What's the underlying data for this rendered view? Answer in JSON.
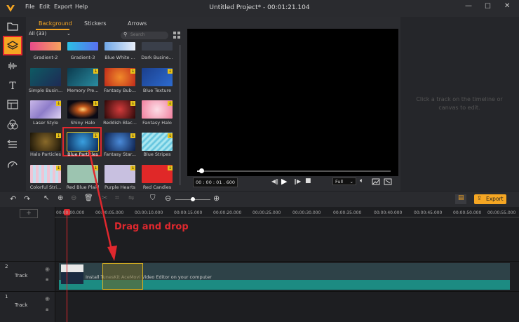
{
  "titlebar": {
    "menu": [
      "File",
      "Edit",
      "Export",
      "Help"
    ],
    "title": "Untitled Project* - 00:01:21.104"
  },
  "media": {
    "tabs": [
      "Background",
      "Stickers",
      "Arrows"
    ],
    "filter": "All (33)",
    "search_placeholder": "Search",
    "items": [
      {
        "label": "Gradient-2"
      },
      {
        "label": "Gradient-3"
      },
      {
        "label": "Blue White ..."
      },
      {
        "label": "Dark Busine..."
      },
      {
        "label": "Simple Busin..."
      },
      {
        "label": "Memory Pre..."
      },
      {
        "label": "Fantasy Bub..."
      },
      {
        "label": "Blue Texture"
      },
      {
        "label": "Laser Style"
      },
      {
        "label": "Shiny Halo"
      },
      {
        "label": "Reddish Blac..."
      },
      {
        "label": "Fantasy Halo"
      },
      {
        "label": "Halo Particles"
      },
      {
        "label": "Blue Particles"
      },
      {
        "label": "Fantasy Star..."
      },
      {
        "label": "Blue Stripes"
      },
      {
        "label": "Colorful Stri..."
      },
      {
        "label": "Red Blue Plaid"
      },
      {
        "label": "Purple Hearts"
      },
      {
        "label": "Red Candies"
      }
    ]
  },
  "preview": {
    "timecode": "00 : 00 : 01 . 600",
    "quality": "Full",
    "progress": 0.02
  },
  "properties": {
    "hint": "Click a track on the timeline or canvas to edit."
  },
  "timeline": {
    "export_label": "Export",
    "ticks": [
      "00:00:00.000",
      "00:00:05.000",
      "00:00:10.000",
      "00:00:15.000",
      "00:00:20.000",
      "00:00:25.000",
      "00:00:30.000",
      "00:00:35.000",
      "00:00:40.000",
      "00:00:45.000",
      "00:00:50.000",
      "00:00:55.000"
    ],
    "tracks": [
      {
        "number": "2",
        "label": "Track",
        "clip_text": "Install TunesKit AceMovi Video Editor on your computer"
      },
      {
        "number": "1",
        "label": "Track"
      }
    ]
  },
  "annotation": {
    "text": "Drag and drop",
    "color": "#e0282e"
  }
}
